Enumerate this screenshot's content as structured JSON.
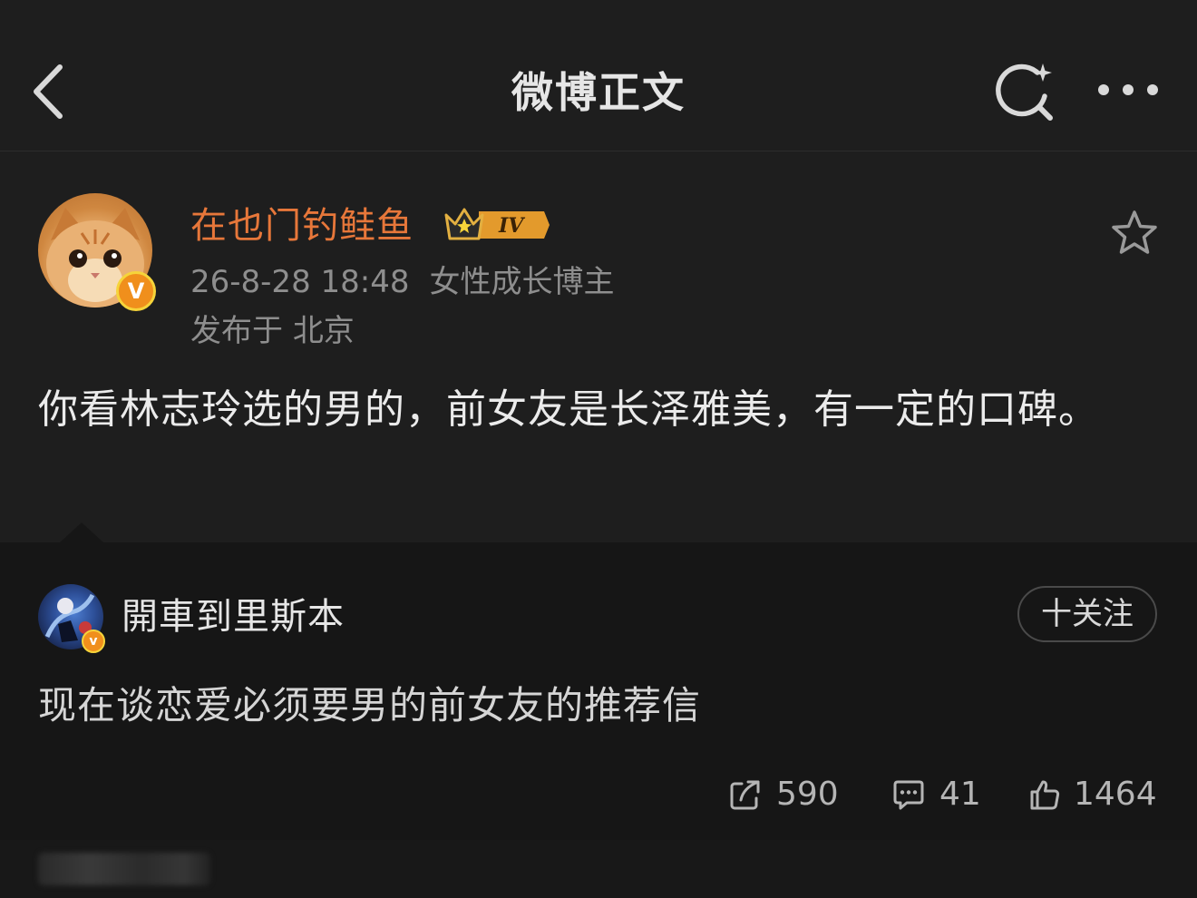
{
  "header": {
    "title": "微博正文",
    "back_icon": "chevron-left-icon",
    "search_icon": "search-sparkle-icon",
    "more_icon": "more-dots-icon"
  },
  "post": {
    "author": {
      "name": "在也门钓鲑鱼",
      "avatar": "orange-cat-avatar",
      "verified": true,
      "verify_mark": "V",
      "level_badge": "IV"
    },
    "timestamp": "26-8-28 18:48",
    "author_tag": "女性成长博主",
    "location_prefix": "发布于",
    "location": "北京",
    "text": "你看林志玲选的男的，前女友是长泽雅美，有一定的口碑。",
    "favorite_icon": "star-outline-icon"
  },
  "repost": {
    "author": {
      "name": "開車到里斯本",
      "avatar": "blue-illustration-avatar",
      "verified": true,
      "verify_mark": "v"
    },
    "follow_label": "十关注",
    "text": "现在谈恋爱必须要男的前女友的推荐信",
    "actions": {
      "share_count": "590",
      "comment_count": "41",
      "like_count": "1464"
    }
  },
  "colors": {
    "background": "#1e1e1e",
    "panel": "#161616",
    "author_name": "#e7773a",
    "meta_text": "#8e8e8e",
    "body_text": "#ebebeb",
    "verify_badge": "#f08f1c"
  }
}
